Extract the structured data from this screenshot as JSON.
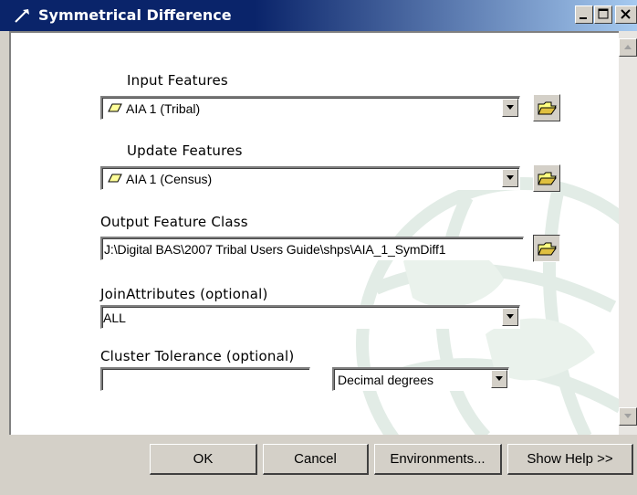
{
  "window": {
    "title": "Symmetrical Difference",
    "controls": [
      "minimize",
      "maximize",
      "close"
    ]
  },
  "form": {
    "input_features": {
      "label": "Input Features",
      "value": "AIA 1 (Tribal)",
      "icon": "polygon-layer-icon"
    },
    "update_features": {
      "label": "Update Features",
      "value": "AIA 1 (Census)",
      "icon": "polygon-layer-icon"
    },
    "output_feature_class": {
      "label": "Output Feature Class",
      "value": "J:\\Digital BAS\\2007 Tribal Users Guide\\shps\\AIA_1_SymDiff1"
    },
    "join_attributes": {
      "label": "JoinAttributes (optional)",
      "value": "ALL"
    },
    "cluster_tolerance": {
      "label": "Cluster Tolerance (optional)",
      "value": "",
      "units": "Decimal degrees"
    }
  },
  "buttons": {
    "ok": "OK",
    "cancel": "Cancel",
    "environments": "Environments...",
    "show_help": "Show Help >>"
  },
  "colors": {
    "title_bar_start": "#0a246a",
    "title_bar_end": "#a6caf0",
    "dialog_face": "#d4d0c8",
    "watermark": "#e6efe8"
  }
}
